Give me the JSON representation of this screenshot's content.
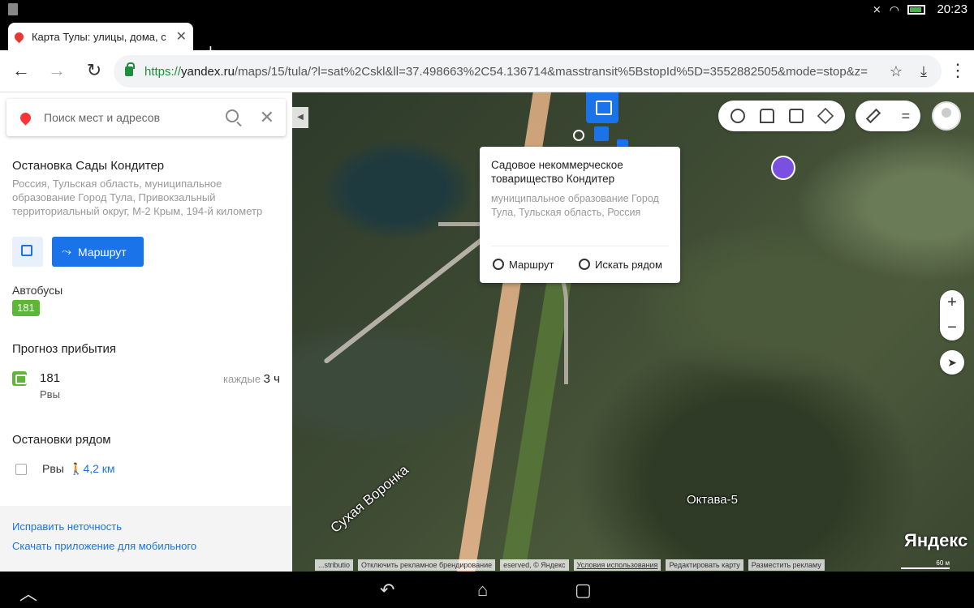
{
  "status_bar": {
    "time": "20:23"
  },
  "tab": {
    "title": "Карта Тулы: улицы, дома, с",
    "close": "✕",
    "new_tab": "+"
  },
  "address_bar": {
    "scheme": "https://",
    "host": "yandex.ru",
    "path": "/maps/15/tula/?l=sat%2Cskl&ll=37.498663%2C54.136714&masstransit%5BstopId%5D=3552882505&mode=stop&z="
  },
  "search": {
    "placeholder": "Поиск мест и адресов"
  },
  "stop": {
    "title": "Остановка Сады Кондитер",
    "address": "Россия, Тульская область, муниципальное образование Город Тула, Привокзальный территориальный округ, М-2 Крым, 194-й километр",
    "route_button": "Маршрут"
  },
  "buses": {
    "label": "Автобусы",
    "badge": "181"
  },
  "arrival": {
    "heading": "Прогноз прибытия",
    "number": "181",
    "destination": "Рвы",
    "freq_prefix": "каждые",
    "freq_value": "3 ч"
  },
  "nearby": {
    "heading": "Остановки рядом",
    "name": "Рвы",
    "distance": "4,2 км"
  },
  "footer": {
    "fix_link": "Исправить неточность",
    "app_link": "Скачать приложение для мобильного"
  },
  "popup": {
    "title": "Садовое некоммерческое товарищество Кондитер",
    "description": "муниципальное образование Город Тула, Тульская область, Россия",
    "route": "Маршрут",
    "search_near": "Искать рядом"
  },
  "map": {
    "label_street": "Сухая Воронка",
    "label_place": "Октава-5",
    "logo": "Яндекс",
    "scale": "60 м",
    "copyright": [
      "...stributio",
      "Отключить рекламное брендирование",
      "eserved, © Яндекс",
      "Условия использования",
      "Редактировать карту",
      "Разместить рекламу"
    ],
    "zoom_in": "+",
    "zoom_out": "−"
  },
  "colors": {
    "accent": "#1a73e8",
    "bus_green": "#5eb636"
  },
  "icons": {
    "back": "back-arrow-icon",
    "forward": "forward-arrow-icon",
    "reload": "reload-icon",
    "star": "star-icon",
    "download": "download-icon",
    "menu": "more-icon"
  }
}
